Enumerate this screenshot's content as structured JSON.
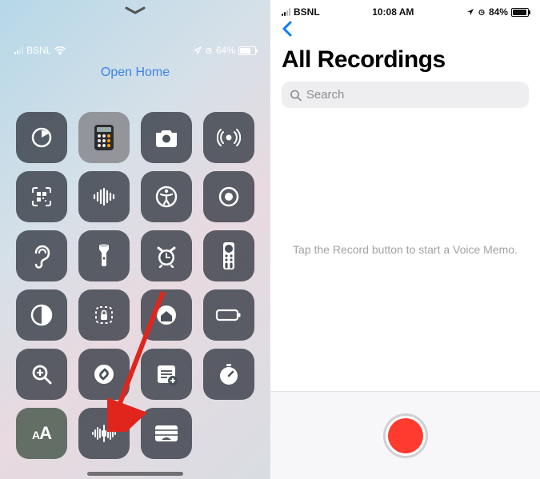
{
  "left": {
    "status": {
      "carrier": "BSNL",
      "battery_pct": "64%"
    },
    "open_home_label": "Open Home",
    "tiles": [
      {
        "name": "timer-icon"
      },
      {
        "name": "calculator-icon"
      },
      {
        "name": "camera-icon"
      },
      {
        "name": "nfc-reader-icon"
      },
      {
        "name": "qr-code-icon"
      },
      {
        "name": "music-recognition-icon"
      },
      {
        "name": "accessibility-icon"
      },
      {
        "name": "screen-recording-icon"
      },
      {
        "name": "hearing-icon"
      },
      {
        "name": "flashlight-icon"
      },
      {
        "name": "alarm-icon"
      },
      {
        "name": "apple-tv-remote-icon"
      },
      {
        "name": "dark-mode-icon"
      },
      {
        "name": "guided-access-icon"
      },
      {
        "name": "home-icon"
      },
      {
        "name": "low-power-mode-icon"
      },
      {
        "name": "magnifier-icon"
      },
      {
        "name": "shazam-icon"
      },
      {
        "name": "quick-note-icon"
      },
      {
        "name": "stopwatch-icon"
      },
      {
        "name": "text-size-icon",
        "label": "AA"
      },
      {
        "name": "voice-memos-icon"
      },
      {
        "name": "wallet-icon"
      }
    ]
  },
  "right": {
    "status": {
      "carrier": "BSNL",
      "time": "10:08 AM",
      "battery_pct": "84%"
    },
    "title": "All Recordings",
    "search_placeholder": "Search",
    "empty_text": "Tap the Record button to start a Voice Memo."
  }
}
